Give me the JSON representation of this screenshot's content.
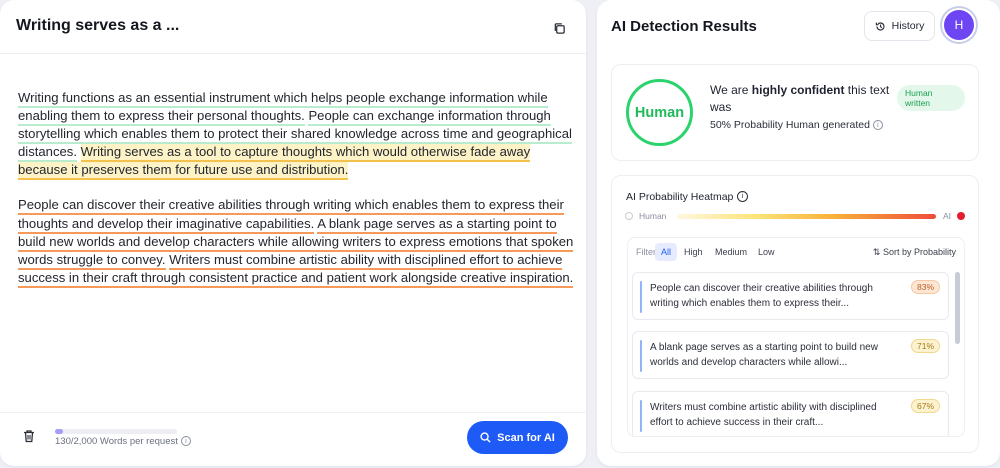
{
  "editor": {
    "title": "Writing serves as a ...",
    "paragraphs": [
      [
        {
          "text": "Writing functions as an essential instrument which helps people exchange information while enabling them to express their personal thoughts.",
          "level": "human"
        },
        {
          "text": " ",
          "level": "none"
        },
        {
          "text": "People can exchange information through storytelling which enables them to protect their shared knowledge across time and geographical distances.",
          "level": "human"
        },
        {
          "text": " ",
          "level": "none"
        },
        {
          "text": "Writing serves as a tool to capture thoughts which would otherwise fade away because it preserves them for future use and distribution.",
          "level": "medium"
        }
      ],
      [
        {
          "text": "People can discover their creative abilities through writing which enables them to express their thoughts and develop their imaginative capabilities.",
          "level": "high"
        },
        {
          "text": " ",
          "level": "none"
        },
        {
          "text": "A blank page serves as a starting point to build new worlds and develop characters while allowing writers to express emotions that spoken words struggle to convey.",
          "level": "high"
        },
        {
          "text": " ",
          "level": "none"
        },
        {
          "text": "Writers must combine artistic ability with disciplined effort to achieve success in their craft through consistent practice and patient work alongside creative inspiration.",
          "level": "high"
        }
      ]
    ],
    "word_count": "130/2,000 Words per request",
    "word_progress": 0.065,
    "scan_label": "Scan for AI"
  },
  "results": {
    "title": "AI Detection Results",
    "history_label": "History",
    "avatar_initial": "H",
    "verdict": "Human",
    "confidence_prefix": "We are ",
    "confidence_strong": "highly confident",
    "confidence_suffix": " this text was",
    "probability": "50% Probability Human generated",
    "badge": "Human written",
    "heatmap_title": "AI Probability Heatmap",
    "scale_human": "Human",
    "scale_ai": "AI",
    "filter_label": "Filter",
    "filters": [
      "All",
      "High",
      "Medium",
      "Low"
    ],
    "sort_label": "Sort by Probability",
    "items": [
      {
        "text": "People can discover their creative abilities through writing which enables them to express their...",
        "pct": "83%"
      },
      {
        "text": "A blank page serves as a starting point to build new worlds and develop characters while allowi...",
        "pct": "71%"
      },
      {
        "text": "Writers must combine artistic ability with disciplined effort to achieve success in their craft...",
        "pct": "67%"
      }
    ]
  },
  "colors": {
    "accent": "#1e5bf6",
    "human_green": "#2ad36b",
    "avatar": "#6d45f3"
  }
}
